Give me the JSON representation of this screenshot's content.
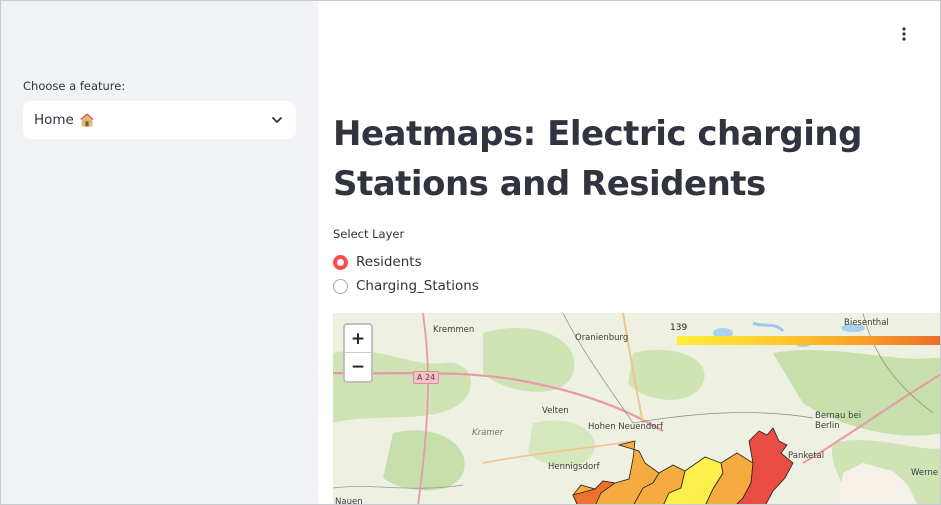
{
  "sidebar": {
    "feature_label": "Choose a feature:",
    "feature_value": "Home",
    "feature_icon": "house-emoji-icon"
  },
  "main": {
    "title_line1": "Heatmaps: Electric charging",
    "title_line2": "Stations and Residents",
    "layer_label": "Select Layer",
    "layers": [
      {
        "label": "Residents",
        "selected": true
      },
      {
        "label": "Charging_Stations",
        "selected": false
      }
    ]
  },
  "map": {
    "zoom_in": "+",
    "zoom_out": "−",
    "legend_min": "139",
    "road_shield": "A 24",
    "places": [
      "Kremmen",
      "Oranienburg",
      "Biesenthal",
      "Velten",
      "Kramer",
      "Hohen Neuendorf",
      "Bernau bei Berlin",
      "Panketal",
      "Hennigsdorf",
      "Werne",
      "Nauen"
    ],
    "heat_colors": [
      "#ffef3a",
      "#ffcd2e",
      "#f7a02a",
      "#ec6b2a",
      "#e8352b"
    ]
  }
}
